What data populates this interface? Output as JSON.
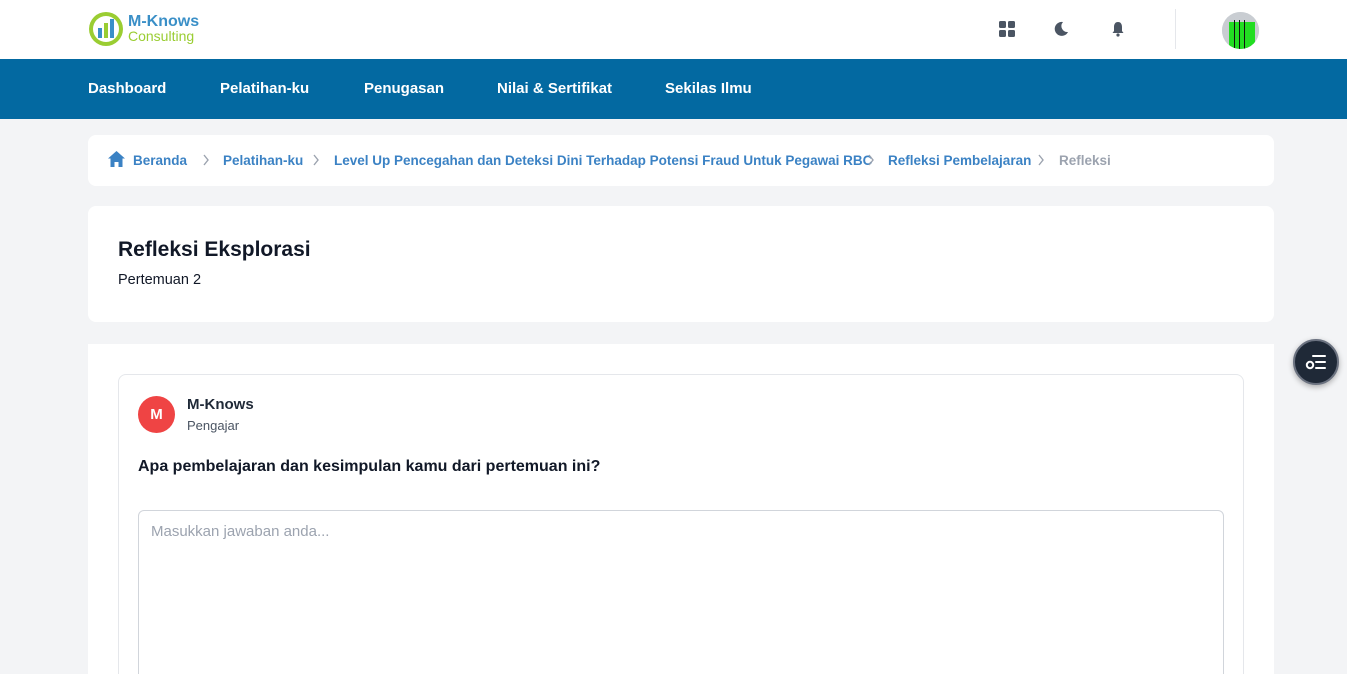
{
  "brand": {
    "name": "M-Knows",
    "tagline": "Consulting"
  },
  "colors": {
    "nav_bg": "#0369a1",
    "accent": "#3b82c4",
    "teacher_avatar": "#ef4444"
  },
  "top_icons": [
    "grid-icon",
    "moon-icon",
    "bell-icon"
  ],
  "nav": {
    "items": [
      {
        "label": "Dashboard"
      },
      {
        "label": "Pelatihan-ku"
      },
      {
        "label": "Penugasan"
      },
      {
        "label": "Nilai & Sertifikat"
      },
      {
        "label": "Sekilas Ilmu"
      }
    ]
  },
  "breadcrumb": {
    "items": [
      {
        "label": "Beranda"
      },
      {
        "label": "Pelatihan-ku"
      },
      {
        "label": "Level Up Pencegahan dan Deteksi Dini Terhadap Potensi Fraud Untuk Pegawai RBC"
      },
      {
        "label": "Refleksi Pembelajaran"
      },
      {
        "label": "Refleksi"
      }
    ]
  },
  "header": {
    "title": "Refleksi Eksplorasi",
    "subtitle": "Pertemuan 2"
  },
  "question": {
    "author_initial": "M",
    "author_name": "M-Knows",
    "author_role": "Pengajar",
    "text": "Apa pembelajaran dan kesimpulan kamu dari pertemuan ini?",
    "answer_value": "",
    "answer_placeholder": "Masukkan jawaban anda..."
  }
}
